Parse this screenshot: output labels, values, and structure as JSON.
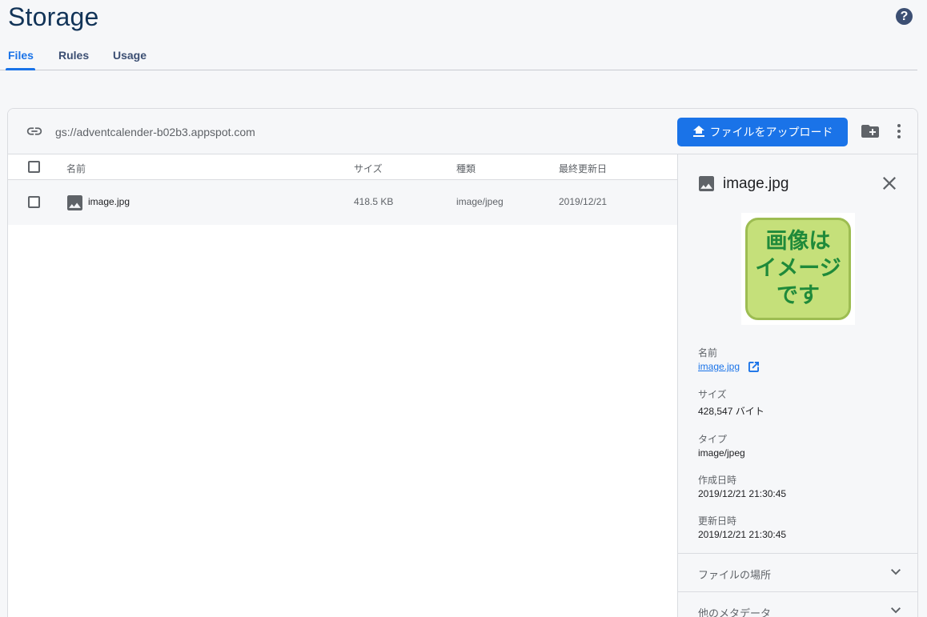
{
  "page": {
    "title": "Storage"
  },
  "tabs": [
    {
      "label": "Files",
      "active": true
    },
    {
      "label": "Rules",
      "active": false
    },
    {
      "label": "Usage",
      "active": false
    }
  ],
  "help": {
    "label": "?"
  },
  "toolbar": {
    "bucket_path": "gs://adventcalender-b02b3.appspot.com",
    "upload_label": "ファイルをアップロード"
  },
  "table": {
    "headers": {
      "name": "名前",
      "size": "サイズ",
      "type": "種類",
      "updated": "最終更新日"
    },
    "rows": [
      {
        "name": "image.jpg",
        "size": "418.5 KB",
        "type": "image/jpeg",
        "updated": "2019/12/21"
      }
    ]
  },
  "details": {
    "title": "image.jpg",
    "preview_text": [
      "画像は",
      "イメージ",
      "です"
    ],
    "name_label": "名前",
    "name_value": "image.jpg",
    "size_label": "サイズ",
    "size_value": "428,547 バイト",
    "type_label": "タイプ",
    "type_value": "image/jpeg",
    "created_label": "作成日時",
    "created_value": "2019/12/21 21:30:45",
    "updated_label": "更新日時",
    "updated_value": "2019/12/21 21:30:45",
    "sections": [
      {
        "label": "ファイルの場所"
      },
      {
        "label": "他のメタデータ"
      }
    ]
  },
  "colors": {
    "accent": "#1a73e8",
    "title": "#123458",
    "nav": "#3c4f73"
  },
  "icons": [
    "help-icon",
    "link-icon",
    "upload-icon",
    "new-folder-icon",
    "more-vert-icon",
    "image-file-icon",
    "close-icon",
    "external-link-icon",
    "chevron-down-icon"
  ]
}
